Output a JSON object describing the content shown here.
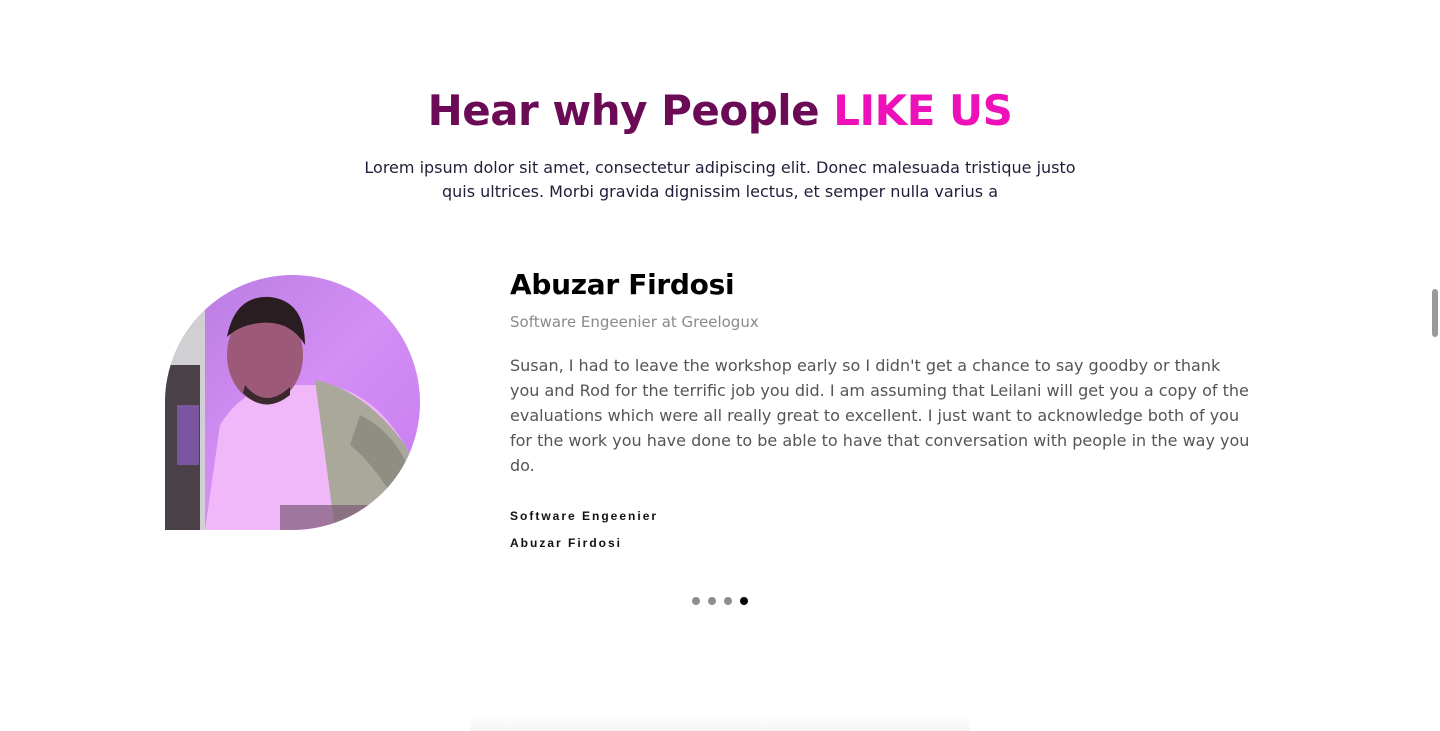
{
  "testimonials": {
    "heading_main": "Hear why People ",
    "heading_accent": "LIKE US",
    "intro": "Lorem ipsum dolor sit amet, consectetur adipiscing elit. Donec malesuada tristique justo quis ultrices. Morbi gravida dignissim lectus, et semper nulla varius a",
    "name": "Abuzar Firdosi",
    "role": "Software Engeenier at Greelogux",
    "quote": "Susan, I had to leave the workshop early so I didn't get a chance to say goodby or thank you and Rod for the terrific job you did. I am assuming that Leilani will get you a copy of the evaluations which were all really great to excellent. I just want to acknowledge both of you for the work you have done to be able to have that conversation with people in the way you do.",
    "meta_title": "Software Engeenier",
    "meta_name": "Abuzar Firdosi",
    "slides_total": 4,
    "active_slide": 4
  },
  "colors": {
    "heading": "#6b0b55",
    "accent": "#ee10b8",
    "dot_inactive": "#8e8e8e",
    "dot_active": "#000000"
  }
}
